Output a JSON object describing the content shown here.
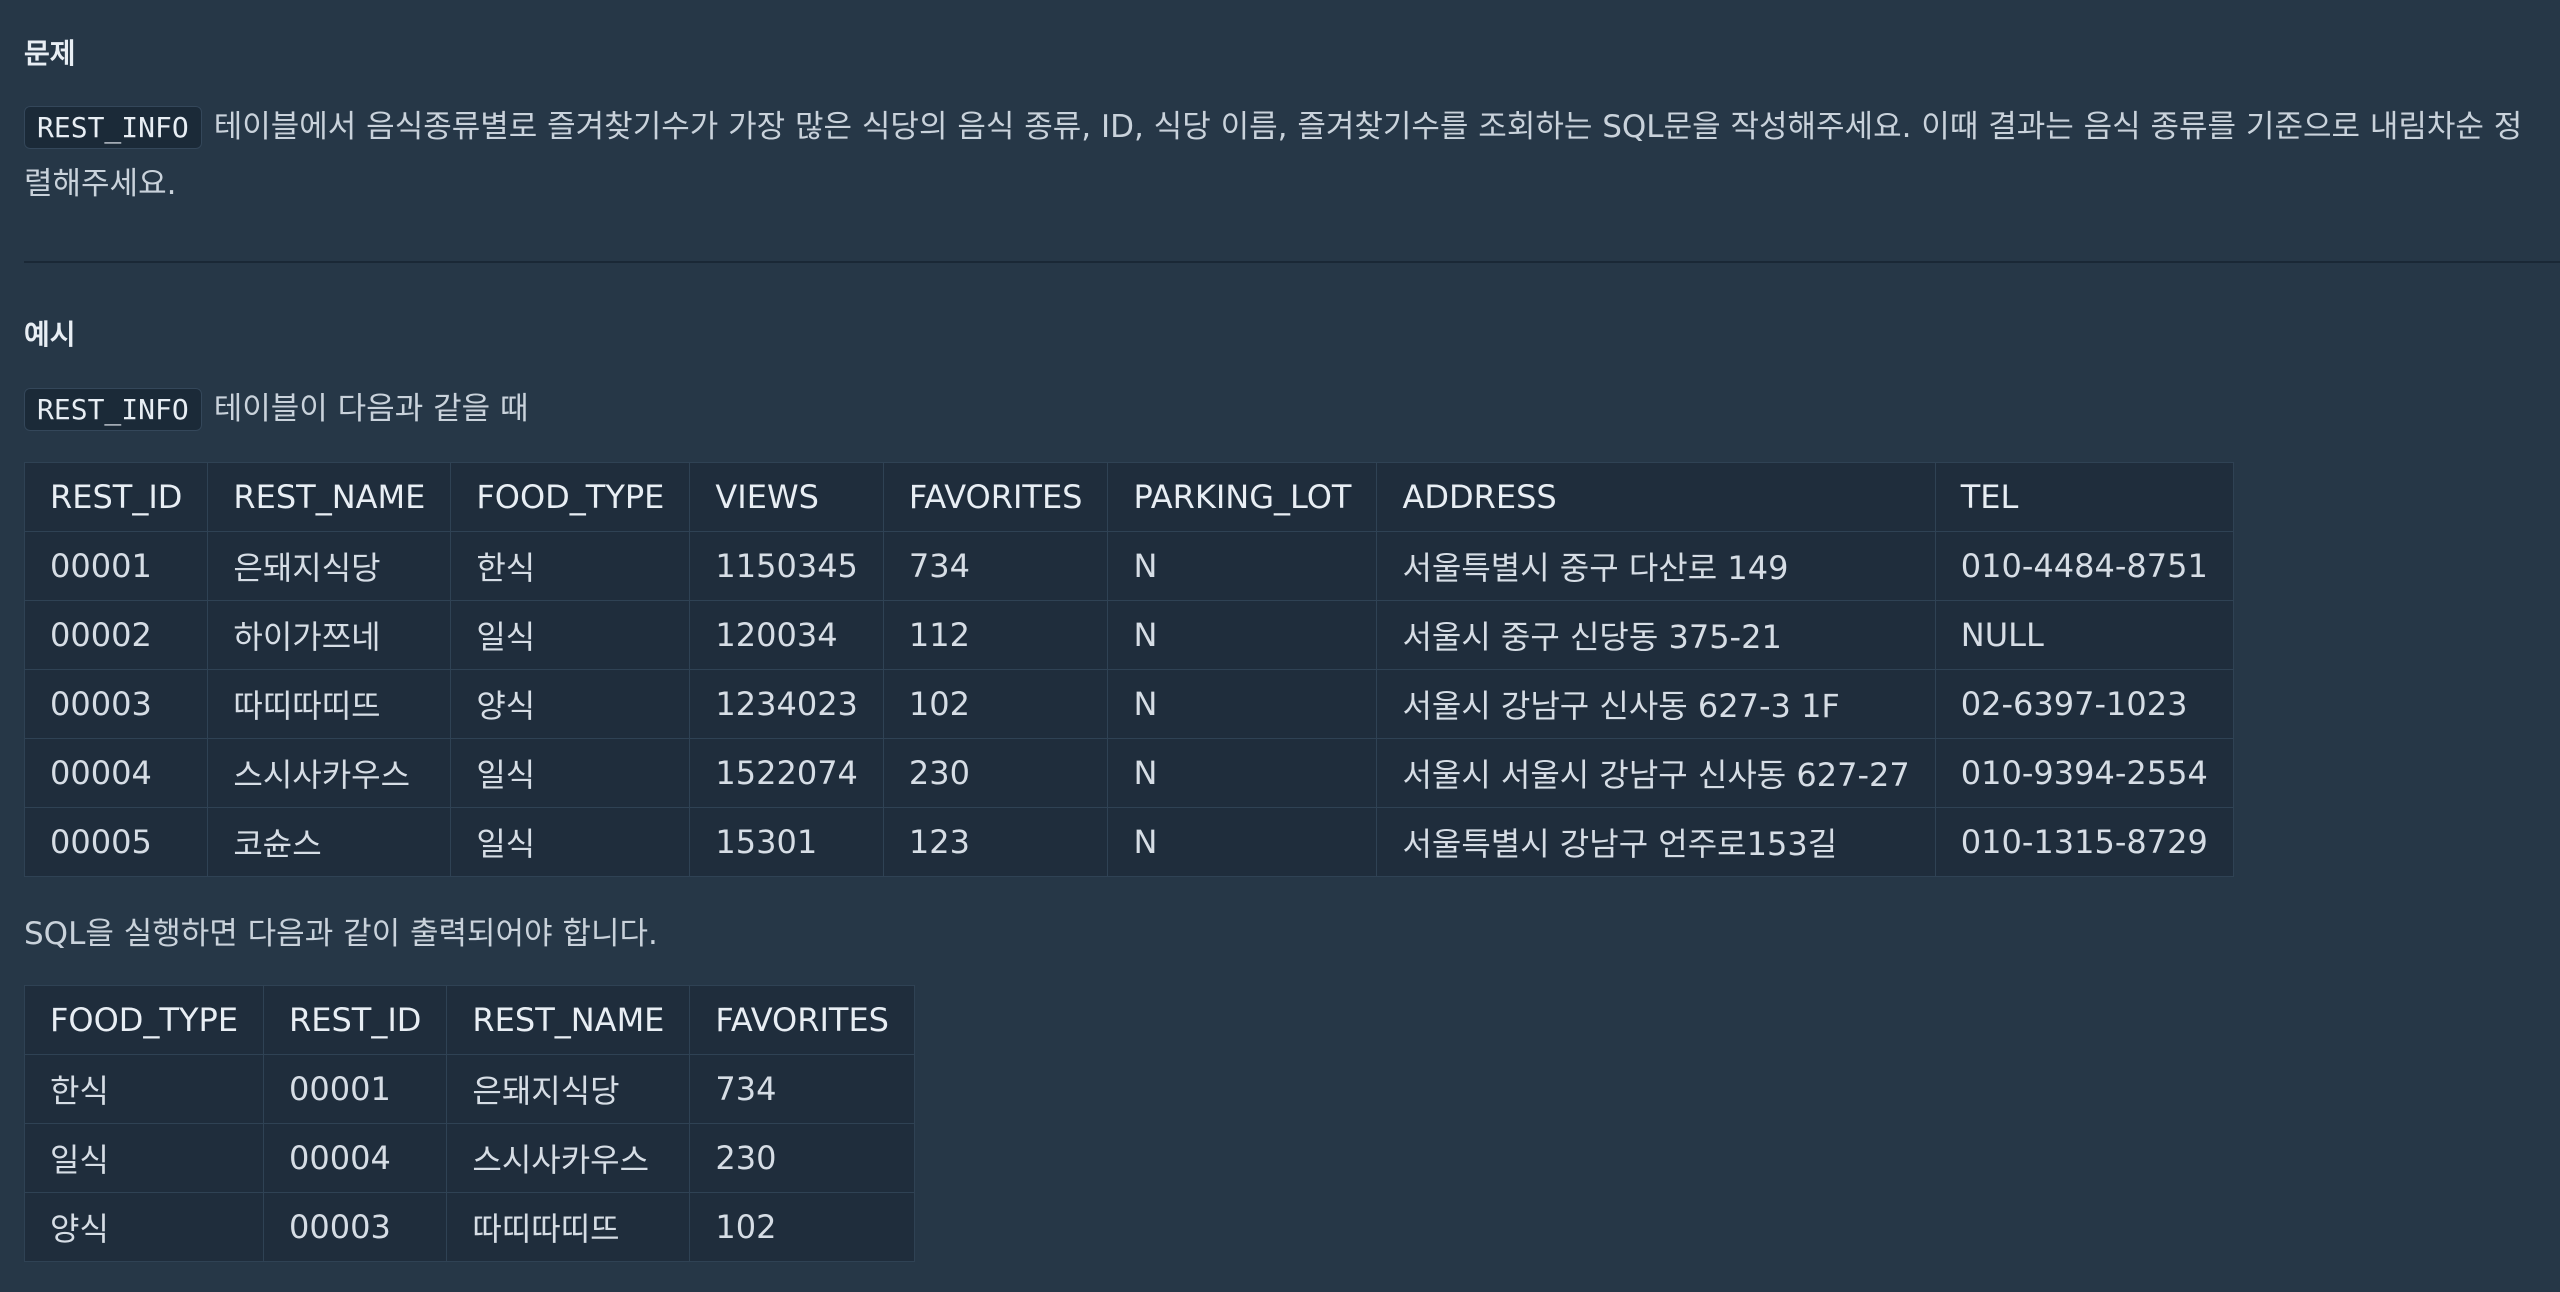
{
  "problem": {
    "title": "문제",
    "table_code": "REST_INFO",
    "text": "테이블에서 음식종류별로 즐겨찾기수가 가장 많은 식당의 음식 종류, ID, 식당 이름, 즐겨찾기수를 조회하는 SQL문을 작성해주세요. 이때 결과는 음식 종류를 기준으로 내림차순 정렬해주세요."
  },
  "example": {
    "title": "예시",
    "table_code": "REST_INFO",
    "intro": "테이블이 다음과 같을 때",
    "rest_table": {
      "headers": [
        "REST_ID",
        "REST_NAME",
        "FOOD_TYPE",
        "VIEWS",
        "FAVORITES",
        "PARKING_LOT",
        "ADDRESS",
        "TEL"
      ],
      "rows": [
        [
          "00001",
          "은돼지식당",
          "한식",
          "1150345",
          "734",
          "N",
          "서울특별시 중구 다산로 149",
          "010-4484-8751"
        ],
        [
          "00002",
          "하이가쯔네",
          "일식",
          "120034",
          "112",
          "N",
          "서울시 중구 신당동 375-21",
          "NULL"
        ],
        [
          "00003",
          "따띠따띠뜨",
          "양식",
          "1234023",
          "102",
          "N",
          "서울시 강남구 신사동 627-3 1F",
          "02-6397-1023"
        ],
        [
          "00004",
          "스시사카우스",
          "일식",
          "1522074",
          "230",
          "N",
          "서울시 서울시 강남구 신사동 627-27",
          "010-9394-2554"
        ],
        [
          "00005",
          "코슌스",
          "일식",
          "15301",
          "123",
          "N",
          "서울특별시 강남구 언주로153길",
          "010-1315-8729"
        ]
      ]
    },
    "result_intro": "SQL을 실행하면 다음과 같이 출력되어야 합니다.",
    "result_table": {
      "headers": [
        "FOOD_TYPE",
        "REST_ID",
        "REST_NAME",
        "FAVORITES"
      ],
      "rows": [
        [
          "한식",
          "00001",
          "은돼지식당",
          "734"
        ],
        [
          "일식",
          "00004",
          "스시사카우스",
          "230"
        ],
        [
          "양식",
          "00003",
          "따띠따띠뜨",
          "102"
        ]
      ]
    }
  }
}
